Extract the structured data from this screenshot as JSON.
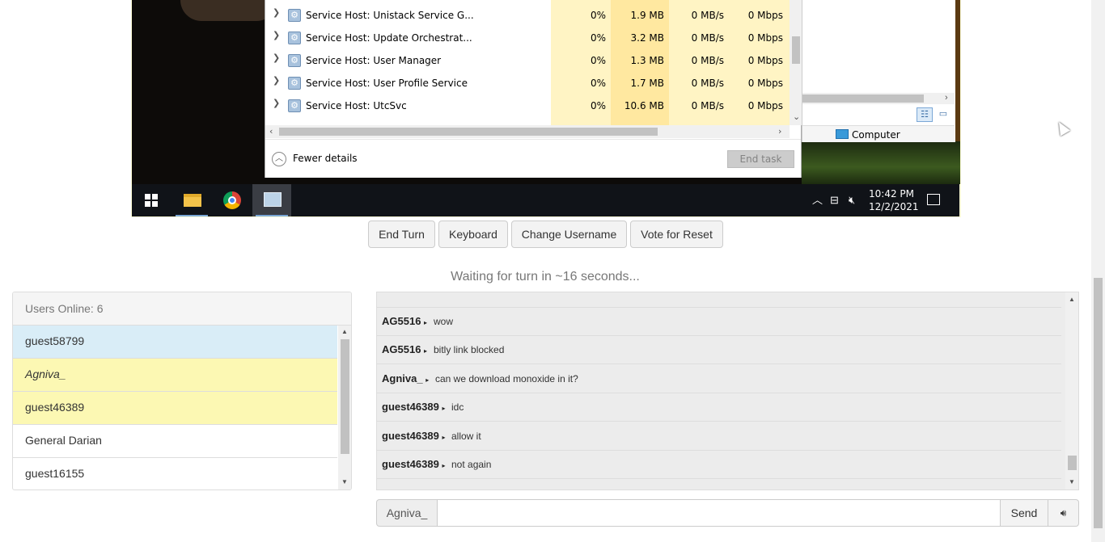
{
  "vm": {
    "task_manager": {
      "processes": [
        {
          "name": "Service Host: Unistack Service G...",
          "cpu": "0%",
          "memory": "1.9 MB",
          "disk": "0 MB/s",
          "network": "0 Mbps"
        },
        {
          "name": "Service Host: Update Orchestrat...",
          "cpu": "0%",
          "memory": "3.2 MB",
          "disk": "0 MB/s",
          "network": "0 Mbps"
        },
        {
          "name": "Service Host: User Manager",
          "cpu": "0%",
          "memory": "1.3 MB",
          "disk": "0 MB/s",
          "network": "0 Mbps"
        },
        {
          "name": "Service Host: User Profile Service",
          "cpu": "0%",
          "memory": "1.7 MB",
          "disk": "0 MB/s",
          "network": "0 Mbps"
        },
        {
          "name": "Service Host: UtcSvc",
          "cpu": "0%",
          "memory": "10.6 MB",
          "disk": "0 MB/s",
          "network": "0 Mbps"
        }
      ],
      "fewer_details_label": "Fewer details",
      "end_task_label": "End task"
    },
    "explorer": {
      "status_item": "Computer"
    },
    "taskbar": {
      "time": "10:42 PM",
      "date": "12/2/2021"
    }
  },
  "controls": {
    "end_turn": "End Turn",
    "keyboard": "Keyboard",
    "change_username": "Change Username",
    "vote_reset": "Vote for Reset"
  },
  "status_text": "Waiting for turn in ~16 seconds...",
  "users_panel": {
    "header": "Users Online: 6",
    "users": [
      {
        "name": "guest58799"
      },
      {
        "name": "Agniva_"
      },
      {
        "name": "guest46389"
      },
      {
        "name": "General Darian"
      },
      {
        "name": "guest16155"
      }
    ]
  },
  "chat": {
    "messages": [
      {
        "user": "AG5516",
        "text": "wow"
      },
      {
        "user": "AG5516",
        "text": "bitly link blocked"
      },
      {
        "user": "Agniva_",
        "text": "can we download monoxide in it?"
      },
      {
        "user": "guest46389",
        "text": "idc"
      },
      {
        "user": "guest46389",
        "text": "allow it"
      },
      {
        "user": "guest46389",
        "text": "not again"
      }
    ]
  },
  "chat_input": {
    "username": "Agniva_",
    "value": "",
    "send_label": "Send"
  }
}
